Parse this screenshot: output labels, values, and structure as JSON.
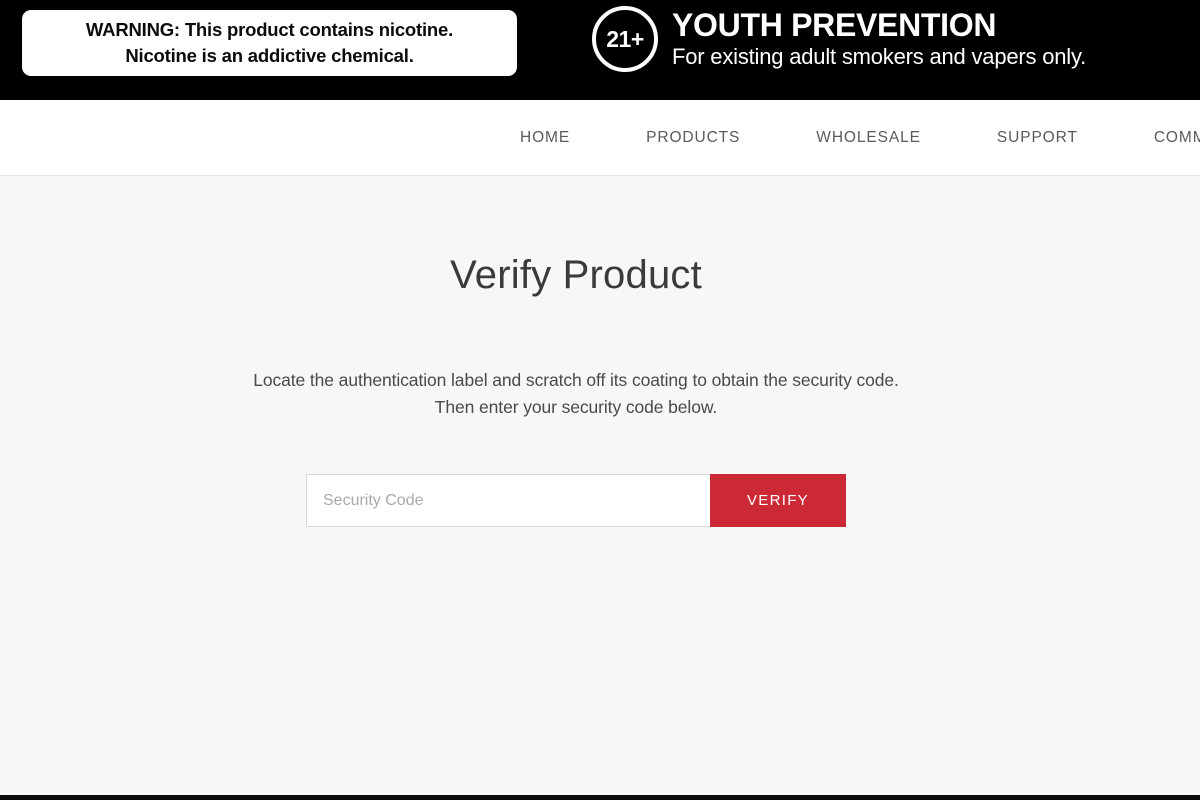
{
  "banner": {
    "nicotine_warning": {
      "line1": "WARNING: This product contains nicotine.",
      "line2": "Nicotine is an addictive chemical."
    },
    "youth_prevention": {
      "age_badge": "21+",
      "title": "YOUTH PREVENTION",
      "subtitle": "For existing adult smokers and vapers only."
    },
    "background_color": "#000000"
  },
  "nav": {
    "items": [
      {
        "label": "HOME"
      },
      {
        "label": "PRODUCTS"
      },
      {
        "label": "WHOLESALE"
      },
      {
        "label": "SUPPORT"
      },
      {
        "label": "COMMUNITY"
      }
    ]
  },
  "main": {
    "title": "Verify Product",
    "instruction_line1": "Locate the authentication label and scratch off its coating to obtain the security code.",
    "instruction_line2": "Then enter your security code below.",
    "form": {
      "input_value": "",
      "input_placeholder": "Security Code",
      "submit_label": "VERIFY",
      "submit_color": "#cc2936"
    }
  },
  "page": {
    "background_color": "#f7f7f7",
    "text_color": "#3a3a3a"
  }
}
